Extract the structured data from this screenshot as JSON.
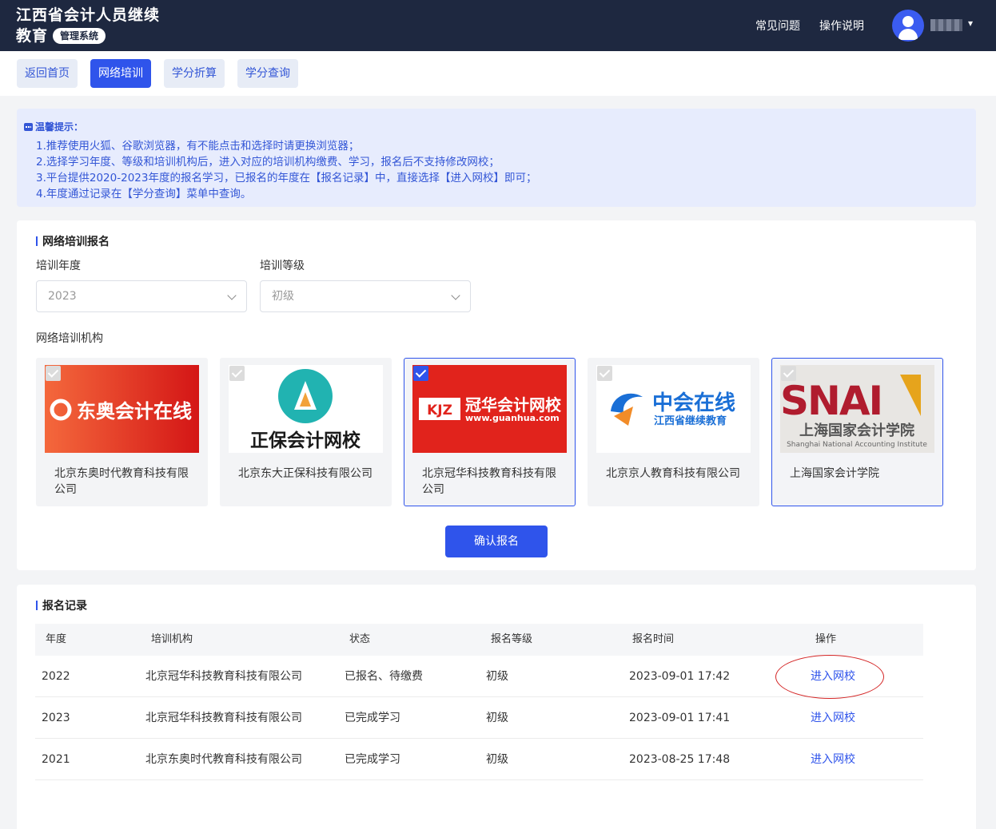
{
  "header": {
    "title_line1": "江西省会计人员继续",
    "title_line2": "教育",
    "badge": "管理系统",
    "links": [
      "常见问题",
      "操作说明"
    ]
  },
  "tabs": [
    "返回首页",
    "网络培训",
    "学分折算",
    "学分查询"
  ],
  "tip": {
    "title": "温馨提示：",
    "lines": [
      "1.推荐使用火狐、谷歌浏览器，有不能点击和选择时请更换浏览器；",
      "2.选择学习年度、等级和培训机构后，进入对应的培训机构缴费、学习，报名后不支持修改网校；",
      "3.平台提供2020-2023年度的报名学习，已报名的年度在【报名记录】中，直接选择【进入网校】即可；",
      "4.年度通过记录在【学分查询】菜单中查询。"
    ]
  },
  "register": {
    "title": "网络培训报名",
    "year_label": "培训年度",
    "year_value": "2023",
    "level_label": "培训等级",
    "level_value": "初级",
    "org_label": "网络培训机构",
    "orgs": [
      {
        "logo_text": "东奥会计在线",
        "name": "北京东奥时代教育科技有限公司",
        "checked": false
      },
      {
        "logo_text": "正保会计网校",
        "name": "北京东大正保科技有限公司",
        "checked": false
      },
      {
        "logo_text": "冠华会计网校",
        "logo_sub": "www.guanhua.com",
        "logo_badge": "KJZ",
        "name": "北京冠华科技教育科技有限公司",
        "checked": true
      },
      {
        "logo_text": "中会在线",
        "logo_sub": "江西省继续教育",
        "name": "北京京人教育科技有限公司",
        "checked": false
      },
      {
        "logo_text": "SNAI",
        "logo_sub": "上海国家会计学院",
        "logo_sub2": "Shanghai National Accounting Institute",
        "name": "上海国家会计学院",
        "checked": false
      }
    ],
    "confirm": "确认报名"
  },
  "records": {
    "title": "报名记录",
    "columns": [
      "年度",
      "培训机构",
      "状态",
      "报名等级",
      "报名时间",
      "操作"
    ],
    "rows": [
      {
        "year": "2022",
        "org": "北京冠华科技教育科技有限公司",
        "status": "已报名、待缴费",
        "level": "初级",
        "time": "2023-09-01 17:42",
        "action": "进入网校"
      },
      {
        "year": "2023",
        "org": "北京冠华科技教育科技有限公司",
        "status": "已完成学习",
        "level": "初级",
        "time": "2023-09-01 17:41",
        "action": "进入网校"
      },
      {
        "year": "2021",
        "org": "北京东奥时代教育科技有限公司",
        "status": "已完成学习",
        "level": "初级",
        "time": "2023-08-25 17:48",
        "action": "进入网校"
      }
    ]
  },
  "colors": {
    "accent": "#2f54eb",
    "header_bg": "#1e2840",
    "tip_bg": "#e7ecfd",
    "annotation": "#d42525"
  }
}
